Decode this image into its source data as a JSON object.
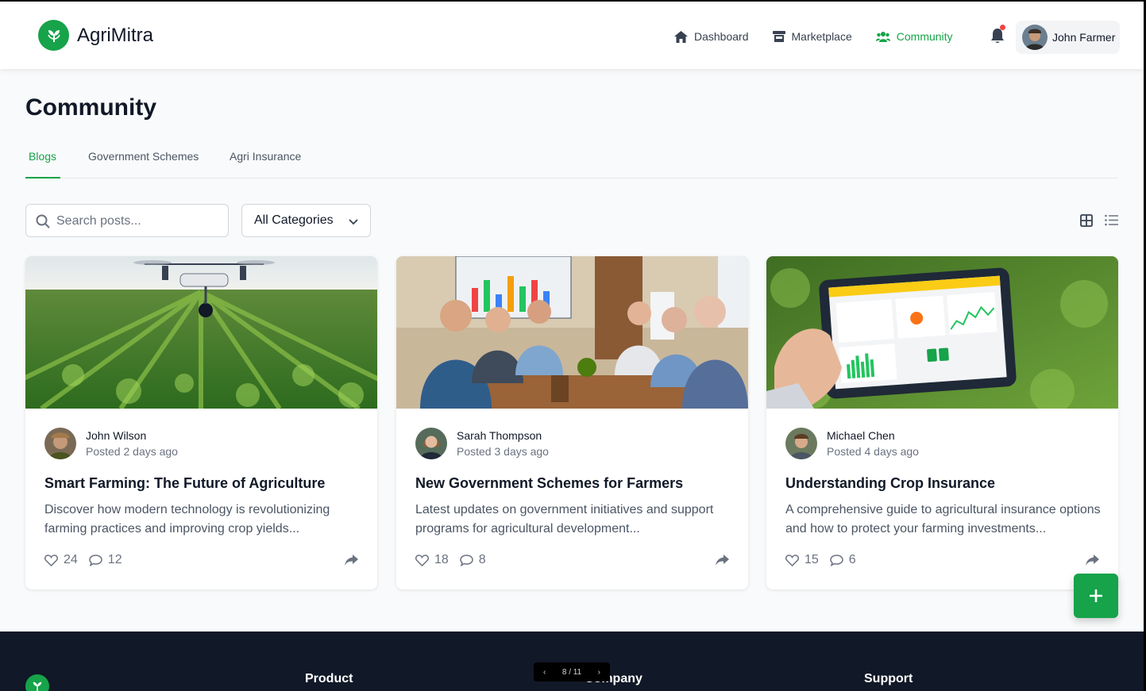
{
  "app": {
    "name": "AgriMitra"
  },
  "nav": {
    "items": [
      {
        "label": "Dashboard",
        "icon": "home-icon"
      },
      {
        "label": "Marketplace",
        "icon": "store-icon"
      },
      {
        "label": "Community",
        "icon": "users-icon",
        "active": true
      }
    ],
    "user_name": "John Farmer"
  },
  "page": {
    "title": "Community"
  },
  "tabs": [
    {
      "label": "Blogs",
      "active": true
    },
    {
      "label": "Government Schemes"
    },
    {
      "label": "Agri Insurance"
    }
  ],
  "filters": {
    "search_placeholder": "Search posts...",
    "category_selected": "All Categories"
  },
  "posts": [
    {
      "author": "John Wilson",
      "posted": "Posted 2 days ago",
      "title": "Smart Farming: The Future of Agriculture",
      "excerpt": "Discover how modern technology is revolutionizing farming practices and improving crop yields...",
      "likes": "24",
      "comments": "12",
      "image": "drone-over-crop-field"
    },
    {
      "author": "Sarah Thompson",
      "posted": "Posted 3 days ago",
      "title": "New Government Schemes for Farmers",
      "excerpt": "Latest updates on government initiatives and support programs for agricultural development...",
      "likes": "18",
      "comments": "8",
      "image": "meeting-room-with-officials"
    },
    {
      "author": "Michael Chen",
      "posted": "Posted 4 days ago",
      "title": "Understanding Crop Insurance",
      "excerpt": "A comprehensive guide to agricultural insurance options and how to protect your farming investments...",
      "likes": "15",
      "comments": "6",
      "image": "tablet-with-crop-dashboard"
    }
  ],
  "footer": {
    "columns": [
      "Product",
      "Company",
      "Support"
    ]
  },
  "pager": {
    "label": "8 / 11"
  },
  "colors": {
    "accent": "#16a34a",
    "footer_bg": "#111827",
    "notification": "#ef4444"
  }
}
